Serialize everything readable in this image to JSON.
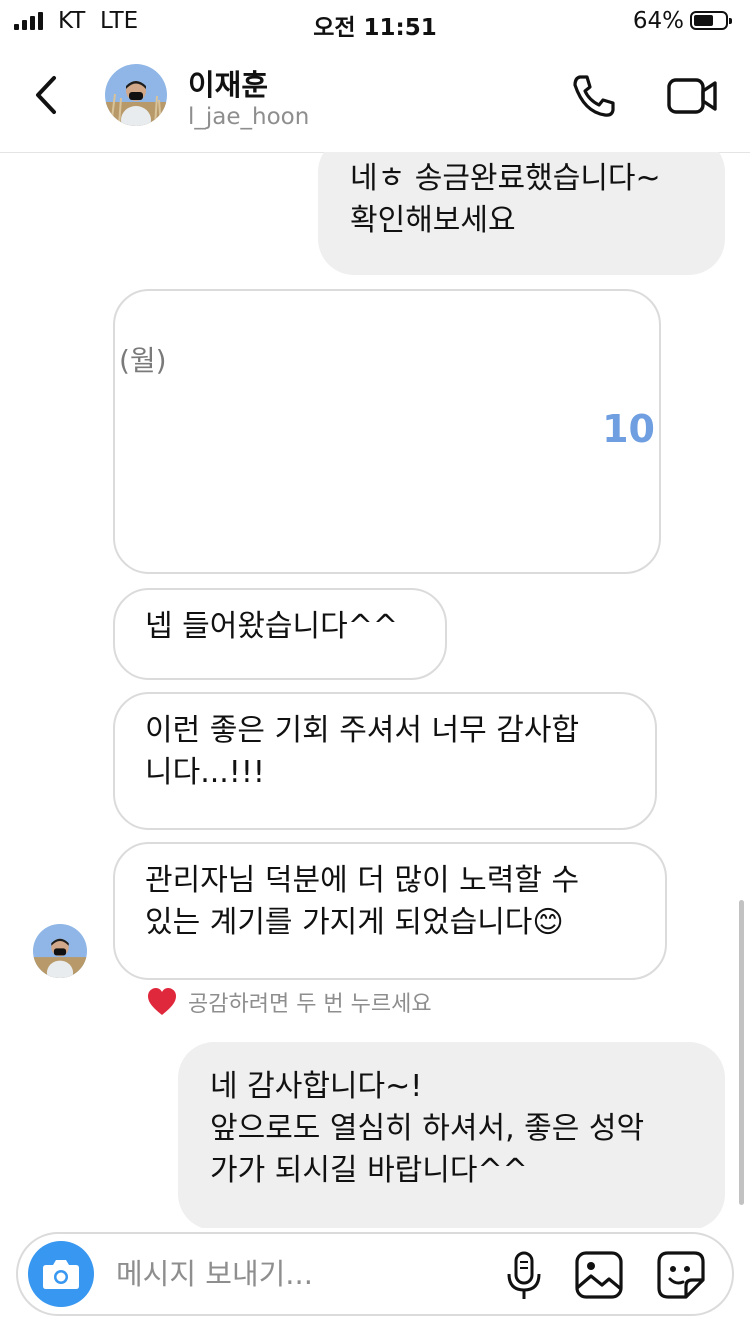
{
  "status_bar": {
    "carrier": "KT  LTE",
    "time": "오전 11:51",
    "battery": "64%",
    "battery_level": 0.64
  },
  "header": {
    "back_icon": "chevron-left-icon",
    "contact_name": "이재훈",
    "contact_handle": "l_jae_hoon",
    "call_icon": "phone-icon",
    "video_icon": "video-camera-icon"
  },
  "messages": {
    "m1": {
      "direction": "sent",
      "text": "네ㅎ 송금완료했습니다~\n확인해보세요"
    },
    "card": {
      "label": "(월)",
      "value": "10"
    },
    "m2": {
      "direction": "received",
      "text": "넵 들어왔습니다^^"
    },
    "m3": {
      "direction": "received",
      "text": "이런 좋은 기회 주셔서 너무 감사합\n니다...!!!"
    },
    "m4": {
      "direction": "received",
      "text": "관리자님 덕분에 더 많이 노력할 수\n있는 계기를 가지게 되었습니다😊"
    },
    "react_hint": "공감하려면 두 번 누르세요",
    "m5": {
      "direction": "sent",
      "text": "네 감사합니다~!\n앞으로도 열심히 하셔서, 좋은 성악\n가가 되시길 바랍니다^^"
    }
  },
  "composer": {
    "placeholder": "메시지 보내기...",
    "camera_icon": "camera-icon",
    "mic_icon": "microphone-icon",
    "gallery_icon": "image-icon",
    "sticker_icon": "sticker-icon"
  },
  "colors": {
    "accent": "#3897f0",
    "sent_bubble": "#efefef",
    "received_border": "#dbdbdb",
    "heart": "#e0283c",
    "card_number": "#6f9fe0"
  }
}
